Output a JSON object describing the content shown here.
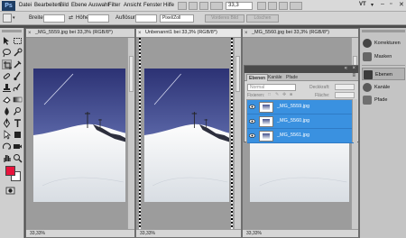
{
  "app": {
    "logo": "Ps"
  },
  "menu": [
    "Datei",
    "Bearbeiten",
    "Bild",
    "Ebene",
    "Auswahl",
    "Filter",
    "Ansicht",
    "Fenster",
    "Hilfe"
  ],
  "menu_right": {
    "zoom": "33,3",
    "workspace": "VT"
  },
  "options": {
    "width_label": "Breite:",
    "height_label": "Höhe:",
    "resolution_label": "Auflösung:",
    "unit_value": "Pixel/Zoll",
    "front_image_button": "Vorderes Bild",
    "delete_button": "Löschen"
  },
  "documents": [
    {
      "title": "_MG_5559.jpg bei 33,3% (RGB/8*)",
      "zoom": "33,33%"
    },
    {
      "title": "Unbenannt1 bei 33,3% (RGB/8*)",
      "zoom": "33,33%"
    },
    {
      "title": "_MG_5560.jpg bei 33,3% (RGB/8*)",
      "zoom": "33,33%"
    }
  ],
  "layers_panel": {
    "tabs": [
      "Ebenen",
      "Kanäle",
      "Pfade"
    ],
    "blend_mode": "Normal",
    "opacity_label": "Deckkraft:",
    "fill_label": "Fläche:",
    "lock_label": "Fixieren:",
    "layers": [
      "_MG_5559.jpg",
      "_MG_5560.jpg",
      "_MG_5561.jpg"
    ]
  },
  "dock": {
    "top": [
      "Korrekturen",
      "Masken"
    ],
    "bottom": [
      "Ebenen",
      "Kanäle",
      "Pfade"
    ]
  },
  "colors": {
    "foreground": "#e8143c",
    "background": "#ffffff",
    "layer_selection": "#3a91e0"
  }
}
